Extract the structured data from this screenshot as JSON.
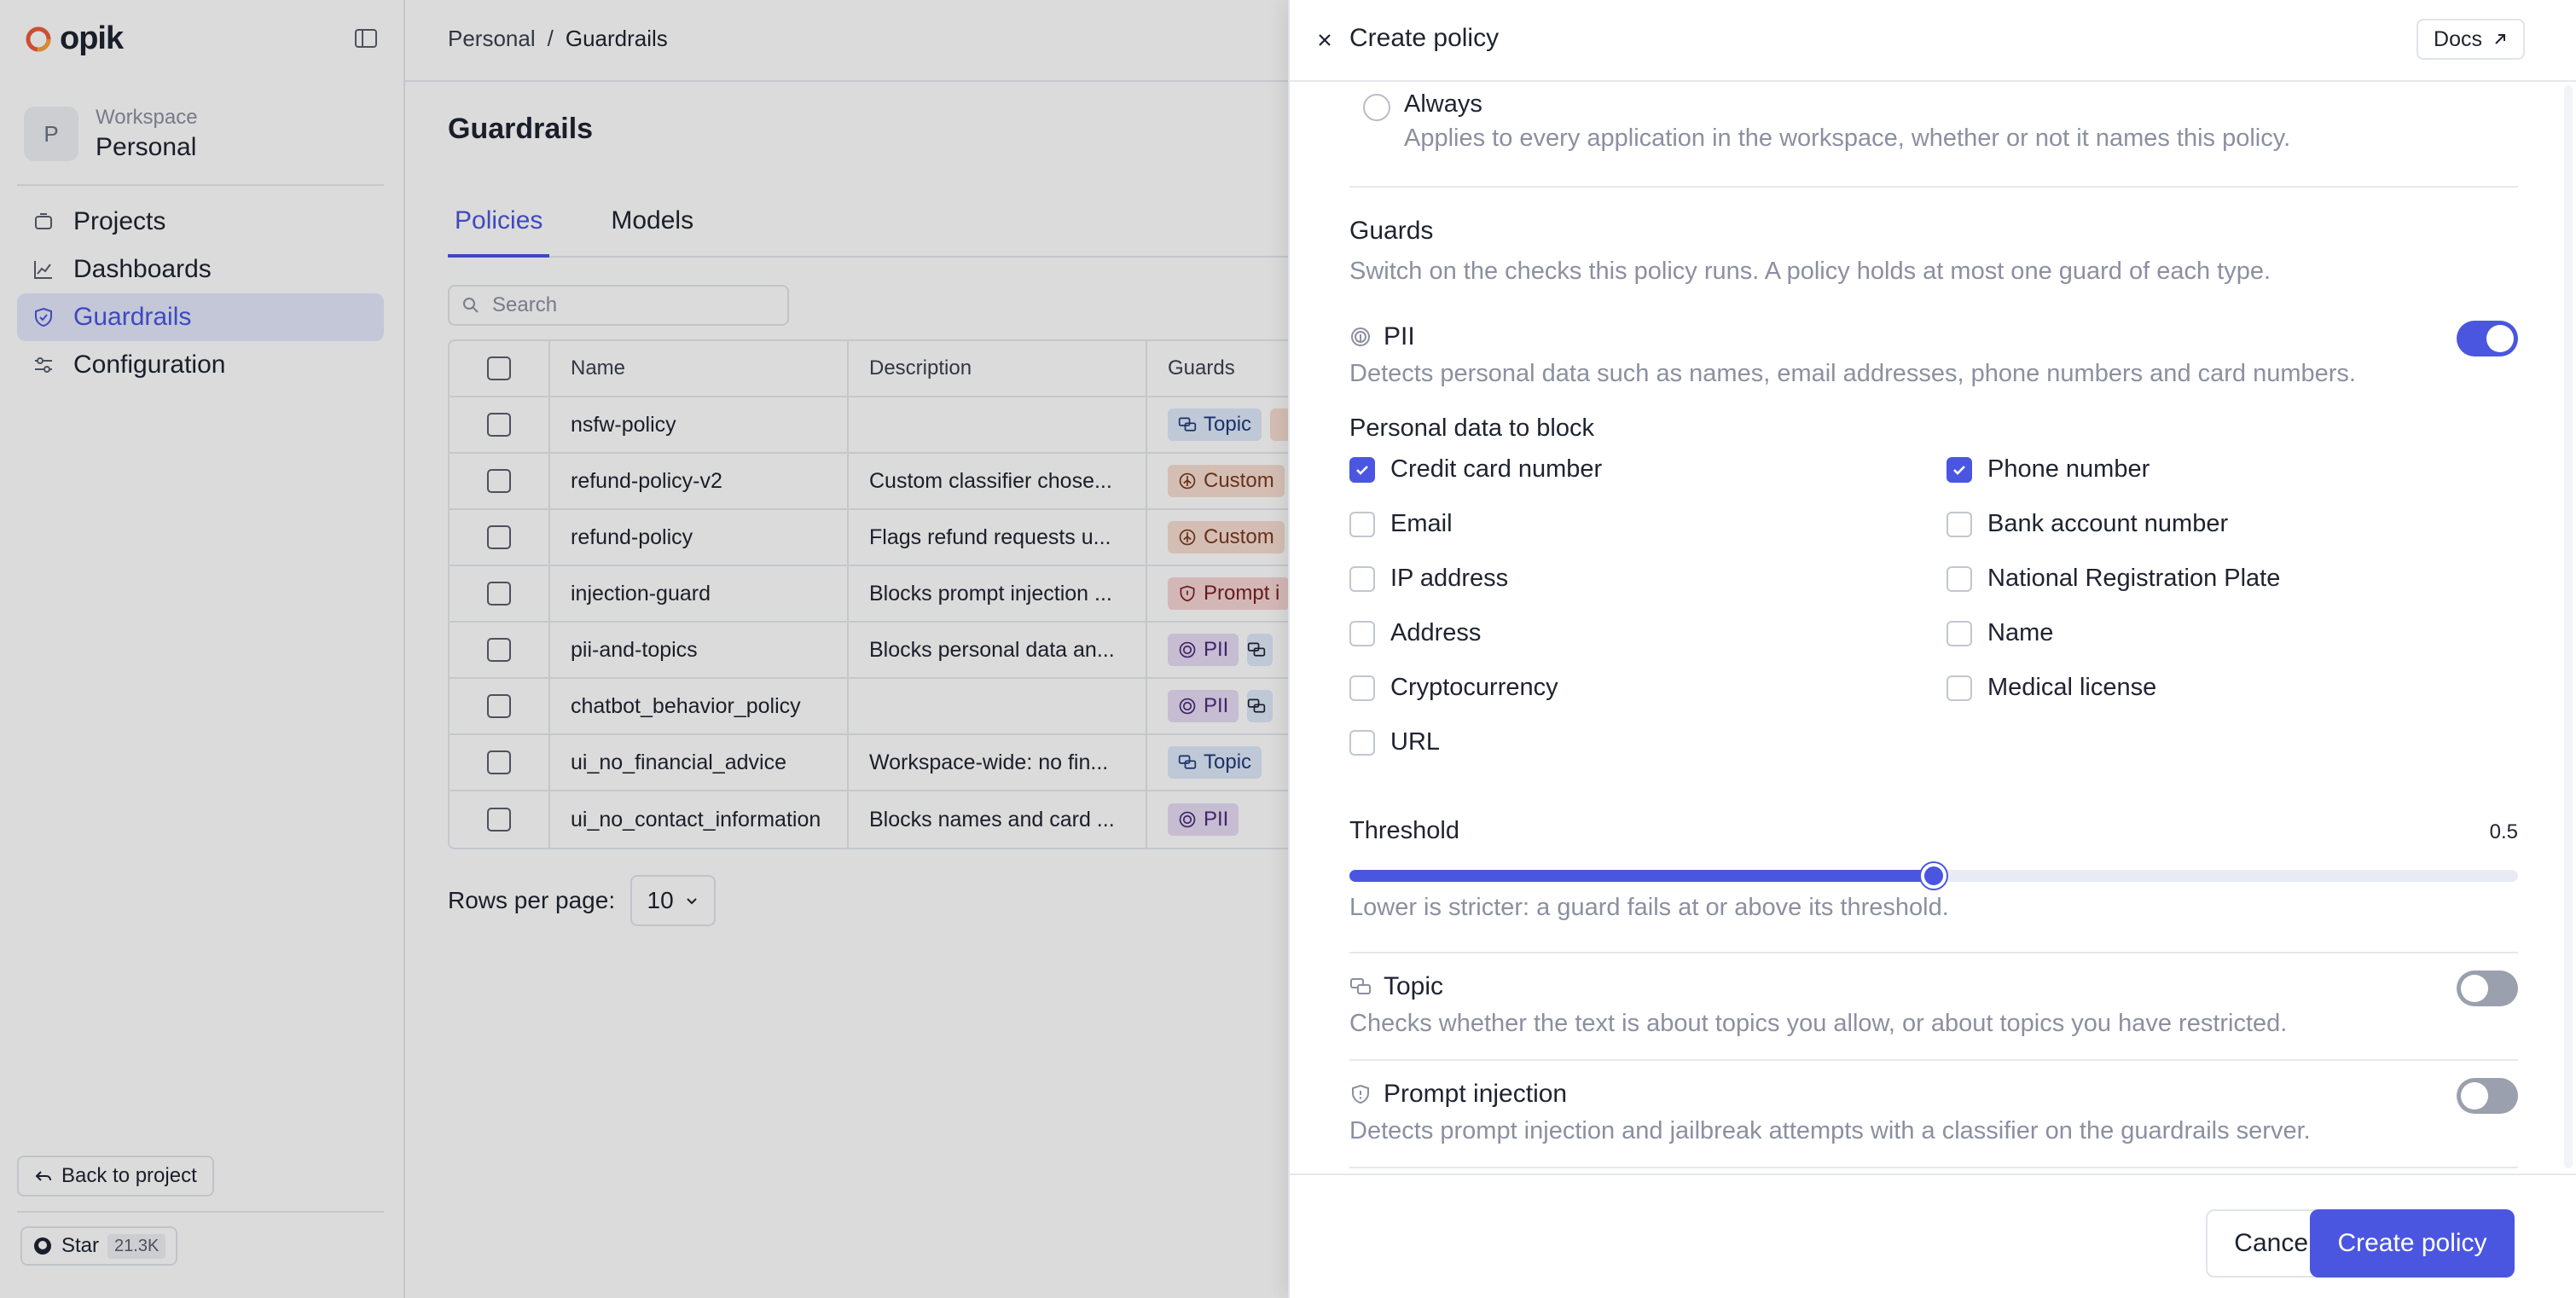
{
  "app": {
    "logo_text": "opik"
  },
  "workspace": {
    "label": "Workspace",
    "name": "Personal",
    "avatar_letter": "P"
  },
  "nav": [
    {
      "label": "Projects",
      "icon": "projects-icon",
      "active": false
    },
    {
      "label": "Dashboards",
      "icon": "dashboards-icon",
      "active": false
    },
    {
      "label": "Guardrails",
      "icon": "shield-icon",
      "active": true
    },
    {
      "label": "Configuration",
      "icon": "sliders-icon",
      "active": false
    }
  ],
  "sidebar_footer": {
    "back_label": "Back to project",
    "star_label": "Star",
    "star_count": "21.3K"
  },
  "breadcrumb": {
    "root": "Personal",
    "separator": "/",
    "current": "Guardrails"
  },
  "page": {
    "title": "Guardrails"
  },
  "tabs": [
    {
      "label": "Policies",
      "active": true
    },
    {
      "label": "Models",
      "active": false
    }
  ],
  "search": {
    "placeholder": "Search"
  },
  "table": {
    "columns": [
      "Name",
      "Description",
      "Guards"
    ],
    "rows": [
      {
        "name": "nsfw-policy",
        "description": "",
        "guards": [
          {
            "label": "Topic",
            "type": "topic"
          },
          {
            "label": "",
            "type": "custom-stub"
          }
        ]
      },
      {
        "name": "refund-policy-v2",
        "description": "Custom classifier chose...",
        "guards": [
          {
            "label": "Custom",
            "type": "custom"
          }
        ]
      },
      {
        "name": "refund-policy",
        "description": "Flags refund requests u...",
        "guards": [
          {
            "label": "Custom",
            "type": "custom"
          }
        ]
      },
      {
        "name": "injection-guard",
        "description": "Blocks prompt injection ...",
        "guards": [
          {
            "label": "Prompt i",
            "type": "prompt"
          }
        ]
      },
      {
        "name": "pii-and-topics",
        "description": "Blocks personal data an...",
        "guards": [
          {
            "label": "PII",
            "type": "pii"
          },
          {
            "label": "",
            "type": "topic-stub"
          }
        ]
      },
      {
        "name": "chatbot_behavior_policy",
        "description": "",
        "guards": [
          {
            "label": "PII",
            "type": "pii"
          },
          {
            "label": "",
            "type": "topic-stub"
          }
        ]
      },
      {
        "name": "ui_no_financial_advice",
        "description": "Workspace-wide: no fin...",
        "guards": [
          {
            "label": "Topic",
            "type": "topic"
          }
        ]
      },
      {
        "name": "ui_no_contact_information",
        "description": "Blocks names and card ...",
        "guards": [
          {
            "label": "PII",
            "type": "pii"
          }
        ]
      }
    ]
  },
  "pagination": {
    "rows_per_page_label": "Rows per page:",
    "rows_per_page_value": "10"
  },
  "drawer": {
    "title": "Create policy",
    "docs_label": "Docs",
    "always_option": {
      "label": "Always",
      "description": "Applies to every application in the workspace, whether or not it names this policy."
    },
    "guards_title": "Guards",
    "guards_description": "Switch on the checks this policy runs. A policy holds at most one guard of each type.",
    "pii": {
      "label": "PII",
      "enabled": true,
      "description": "Detects personal data such as names, email addresses, phone numbers and card numbers.",
      "block_title": "Personal data to block",
      "options_left": [
        {
          "label": "Credit card number",
          "checked": true
        },
        {
          "label": "Email",
          "checked": false
        },
        {
          "label": "IP address",
          "checked": false
        },
        {
          "label": "Address",
          "checked": false
        },
        {
          "label": "Cryptocurrency",
          "checked": false
        },
        {
          "label": "URL",
          "checked": false
        }
      ],
      "options_right": [
        {
          "label": "Phone number",
          "checked": true
        },
        {
          "label": "Bank account number",
          "checked": false
        },
        {
          "label": "National Registration Plate",
          "checked": false
        },
        {
          "label": "Name",
          "checked": false
        },
        {
          "label": "Medical license",
          "checked": false
        }
      ],
      "threshold_label": "Threshold",
      "threshold_value": "0.5",
      "threshold_fraction": 0.5,
      "threshold_hint": "Lower is stricter: a guard fails at or above its threshold."
    },
    "topic": {
      "label": "Topic",
      "enabled": false,
      "description": "Checks whether the text is about topics you allow, or about topics you have restricted."
    },
    "prompt_injection": {
      "label": "Prompt injection",
      "enabled": false,
      "description": "Detects prompt injection and jailbreak attempts with a classifier on the guardrails server."
    },
    "cancel_label": "Cancel",
    "submit_label": "Create policy"
  },
  "colors": {
    "accent": "#4a56e0",
    "active_nav_bg": "#e4e8fb"
  }
}
